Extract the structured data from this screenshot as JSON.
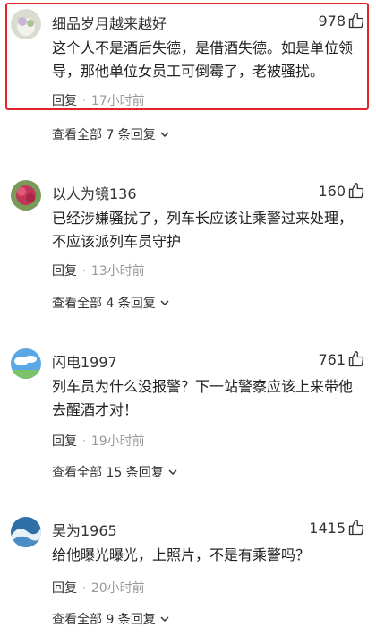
{
  "comments": [
    {
      "username": "细品岁月越来越好",
      "likes": "978",
      "text": "这个人不是酒后失德，是借酒失德。如是单位领导，那他单位女员工可倒霉了，老被骚扰。",
      "reply_label": "回复",
      "dot": "·",
      "time": "17小时前",
      "view_all": "查看全部 7 条回复"
    },
    {
      "username": "以人为镜136",
      "likes": "160",
      "text": "已经涉嫌骚扰了，列车长应该让乘警过来处理，不应该派列车员守护",
      "reply_label": "回复",
      "dot": "·",
      "time": "13小时前",
      "view_all": "查看全部 4 条回复"
    },
    {
      "username": "闪电1997",
      "likes": "761",
      "text": "列车员为什么没报警？下一站警察应该上来带他去醒酒才对！",
      "reply_label": "回复",
      "dot": "·",
      "time": "19小时前",
      "view_all": "查看全部 15 条回复"
    },
    {
      "username": "吴为1965",
      "likes": "1415",
      "text": "给他曝光曝光，上照片，不是有乘警吗？",
      "reply_label": "回复",
      "dot": "·",
      "time": "20小时前",
      "view_all": "查看全部 9 条回复"
    }
  ],
  "colors": {
    "highlight_border": "#e0252b",
    "time_gray": "#999999"
  },
  "icons": {
    "like": "thumbs-up-icon",
    "expand": "chevron-down-icon"
  }
}
